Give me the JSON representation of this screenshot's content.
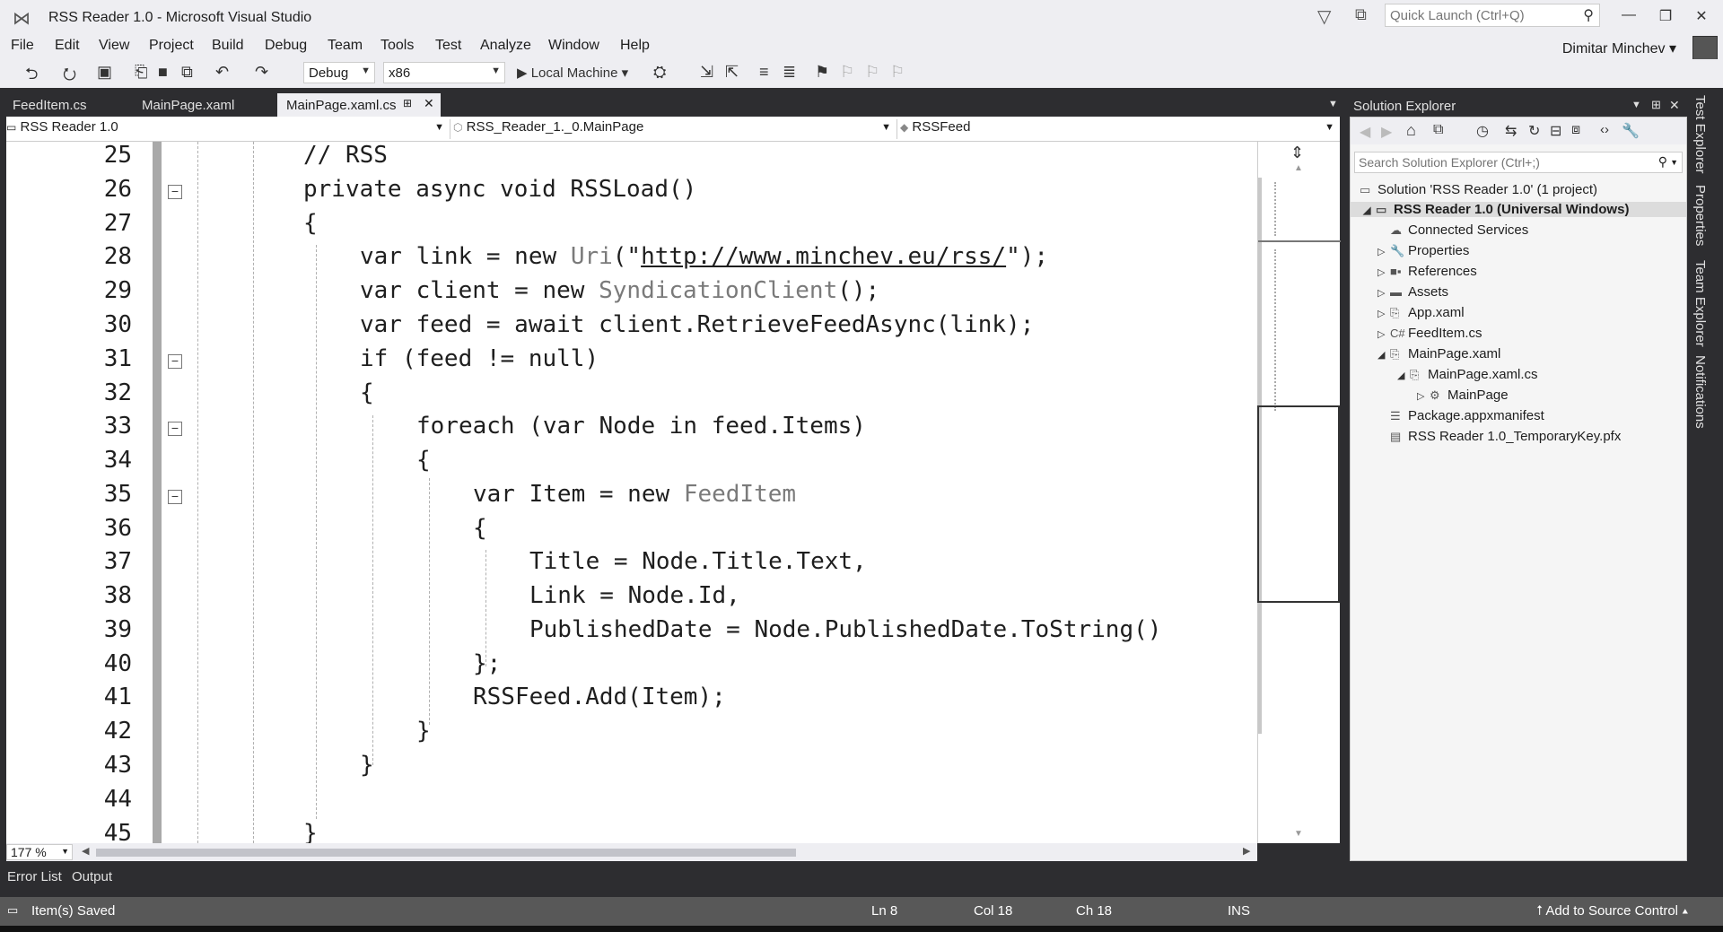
{
  "window": {
    "title": "RSS Reader 1.0 - Microsoft Visual Studio"
  },
  "quick_launch": {
    "placeholder": "Quick Launch (Ctrl+Q)"
  },
  "menu": [
    "File",
    "Edit",
    "View",
    "Project",
    "Build",
    "Debug",
    "Team",
    "Tools",
    "Test",
    "Analyze",
    "Window",
    "Help"
  ],
  "user": {
    "name": "Dimitar Minchev"
  },
  "toolbar": {
    "config": "Debug",
    "platform": "x86",
    "run_label": "Local Machine"
  },
  "doc_tabs": [
    "FeedItem.cs",
    "MainPage.xaml",
    "MainPage.xaml.cs"
  ],
  "nav": {
    "project": "RSS Reader 1.0",
    "class": "RSS_Reader_1._0.MainPage",
    "member": "RSSFeed"
  },
  "code": {
    "line_numbers": [
      "25",
      "26",
      "27",
      "28",
      "29",
      "30",
      "31",
      "32",
      "33",
      "34",
      "35",
      "36",
      "37",
      "38",
      "39",
      "40",
      "41",
      "42",
      "43",
      "44",
      "45"
    ],
    "l25": "// RSS",
    "l26": "private async void RSSLoad()",
    "l27": "{",
    "l28a": "var link = new ",
    "l28type": "Uri",
    "l28b": "(\"",
    "l28url": "http://www.minchev.eu/rss/",
    "l28c": "\");",
    "l29a": "var client = new ",
    "l29type": "SyndicationClient",
    "l29b": "();",
    "l30": "var feed = await client.RetrieveFeedAsync(link);",
    "l31": "if (feed != null)",
    "l32": "{",
    "l33": "foreach (var Node in feed.Items)",
    "l34": "{",
    "l35a": "var Item = new ",
    "l35type": "FeedItem",
    "l36": "{",
    "l37": "Title = Node.Title.Text,",
    "l38": "Link = Node.Id,",
    "l39": "PublishedDate = Node.PublishedDate.ToString()",
    "l40": "};",
    "l41": "RSSFeed.Add(Item);",
    "l42": "}",
    "l43": "}",
    "l45": "}"
  },
  "zoom": "177 %",
  "bottom_tabs": [
    "Error List",
    "Output"
  ],
  "status": {
    "message": "Item(s) Saved",
    "ln": "Ln 8",
    "col": "Col 18",
    "ch": "Ch 18",
    "mode": "INS",
    "source_control": "Add to Source Control"
  },
  "solution_explorer": {
    "title": "Solution Explorer",
    "search_placeholder": "Search Solution Explorer (Ctrl+;)",
    "solution": "Solution 'RSS Reader 1.0' (1 project)",
    "project": "RSS Reader 1.0 (Universal Windows)",
    "items": [
      "Connected Services",
      "Properties",
      "References",
      "Assets",
      "App.xaml",
      "FeedItem.cs",
      "MainPage.xaml",
      "MainPage.xaml.cs",
      "MainPage",
      "Package.appxmanifest",
      "RSS Reader 1.0_TemporaryKey.pfx"
    ]
  },
  "side_tabs": [
    "Test Explorer",
    "Properties",
    "Team Explorer",
    "Notifications"
  ]
}
